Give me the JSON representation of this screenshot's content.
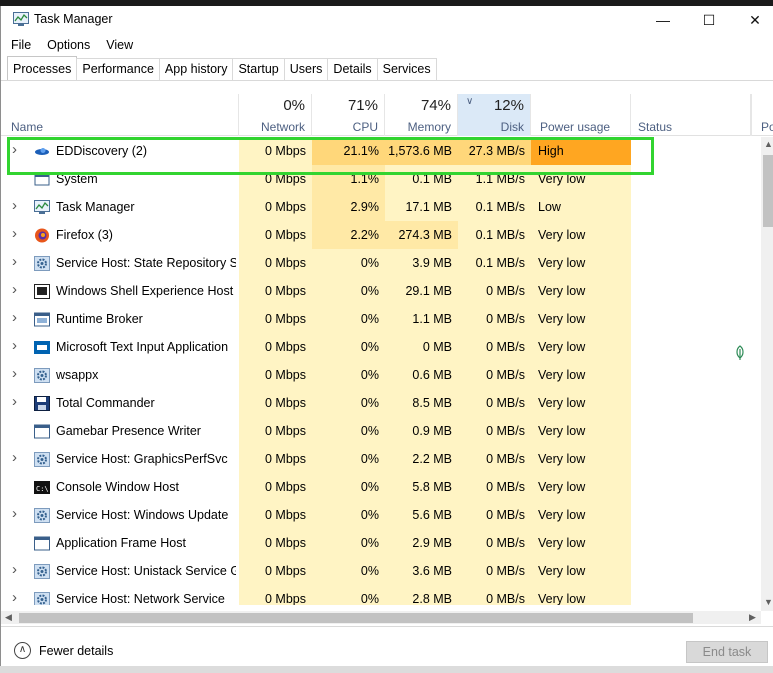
{
  "window": {
    "title": "Task Manager",
    "minimize_glyph": "—",
    "maximize_glyph": "☐",
    "close_glyph": "✕"
  },
  "menu": [
    "File",
    "Options",
    "View"
  ],
  "tabs": [
    "Processes",
    "Performance",
    "App history",
    "Startup",
    "Users",
    "Details",
    "Services"
  ],
  "header": {
    "name": "Name",
    "network": {
      "pct": "0%",
      "label": "Network"
    },
    "cpu": {
      "pct": "71%",
      "label": "CPU"
    },
    "memory": {
      "pct": "74%",
      "label": "Memory"
    },
    "disk": {
      "pct": "12%",
      "label": "Disk"
    },
    "power": "Power usage",
    "status": "Status",
    "more": "Po"
  },
  "rows": [
    {
      "name": "EDDiscovery (2)",
      "expand": true,
      "icon": "eddiscovery-icon",
      "network": "0 Mbps",
      "cpu": "21.1%",
      "memory": "1,573.6 MB",
      "disk": "27.3 MB/s",
      "power": "High"
    },
    {
      "name": "System",
      "expand": false,
      "icon": "system-window-icon",
      "network": "0 Mbps",
      "cpu": "1.1%",
      "memory": "0.1 MB",
      "disk": "1.1 MB/s",
      "power": "Very low"
    },
    {
      "name": "Task Manager",
      "expand": true,
      "icon": "task-manager-icon",
      "network": "0 Mbps",
      "cpu": "2.9%",
      "memory": "17.1 MB",
      "disk": "0.1 MB/s",
      "power": "Low"
    },
    {
      "name": "Firefox (3)",
      "expand": true,
      "icon": "firefox-icon",
      "network": "0 Mbps",
      "cpu": "2.2%",
      "memory": "274.3 MB",
      "disk": "0.1 MB/s",
      "power": "Very low"
    },
    {
      "name": "Service Host: State Repository S...",
      "expand": true,
      "icon": "gear-icon",
      "network": "0 Mbps",
      "cpu": "0%",
      "memory": "3.9 MB",
      "disk": "0.1 MB/s",
      "power": "Very low"
    },
    {
      "name": "Windows Shell Experience Host",
      "expand": true,
      "icon": "shell-host-icon",
      "network": "0 Mbps",
      "cpu": "0%",
      "memory": "29.1 MB",
      "disk": "0 MB/s",
      "power": "Very low"
    },
    {
      "name": "Runtime Broker",
      "expand": true,
      "icon": "runtime-broker-icon",
      "network": "0 Mbps",
      "cpu": "0%",
      "memory": "1.1 MB",
      "disk": "0 MB/s",
      "power": "Very low"
    },
    {
      "name": "Microsoft Text Input Application",
      "expand": true,
      "icon": "text-input-icon",
      "network": "0 Mbps",
      "cpu": "0%",
      "memory": "0 MB",
      "disk": "0 MB/s",
      "power": "Very low"
    },
    {
      "name": "wsappx",
      "expand": true,
      "icon": "gear-icon",
      "network": "0 Mbps",
      "cpu": "0%",
      "memory": "0.6 MB",
      "disk": "0 MB/s",
      "power": "Very low"
    },
    {
      "name": "Total Commander",
      "expand": true,
      "icon": "floppy-disk-icon",
      "network": "0 Mbps",
      "cpu": "0%",
      "memory": "8.5 MB",
      "disk": "0 MB/s",
      "power": "Very low"
    },
    {
      "name": "Gamebar Presence Writer",
      "expand": false,
      "icon": "app-window-icon",
      "network": "0 Mbps",
      "cpu": "0%",
      "memory": "0.9 MB",
      "disk": "0 MB/s",
      "power": "Very low"
    },
    {
      "name": "Service Host: GraphicsPerfSvc",
      "expand": true,
      "icon": "gear-icon",
      "network": "0 Mbps",
      "cpu": "0%",
      "memory": "2.2 MB",
      "disk": "0 MB/s",
      "power": "Very low"
    },
    {
      "name": "Console Window Host",
      "expand": false,
      "icon": "console-icon",
      "network": "0 Mbps",
      "cpu": "0%",
      "memory": "5.8 MB",
      "disk": "0 MB/s",
      "power": "Very low"
    },
    {
      "name": "Service Host: Windows Update",
      "expand": true,
      "icon": "gear-icon",
      "network": "0 Mbps",
      "cpu": "0%",
      "memory": "5.6 MB",
      "disk": "0 MB/s",
      "power": "Very low"
    },
    {
      "name": "Application Frame Host",
      "expand": false,
      "icon": "app-window-icon",
      "network": "0 Mbps",
      "cpu": "0%",
      "memory": "2.9 MB",
      "disk": "0 MB/s",
      "power": "Very low"
    },
    {
      "name": "Service Host: Unistack Service G...",
      "expand": true,
      "icon": "gear-icon",
      "network": "0 Mbps",
      "cpu": "0%",
      "memory": "3.6 MB",
      "disk": "0 MB/s",
      "power": "Very low"
    },
    {
      "name": "Service Host: Network Service",
      "expand": true,
      "icon": "gear-icon",
      "network": "0 Mbps",
      "cpu": "0%",
      "memory": "2.8 MB",
      "disk": "0 MB/s",
      "power": "Very low"
    }
  ],
  "footer": {
    "fewer_details": "Fewer details",
    "end_task": "End task"
  },
  "colors": {
    "cell_light": "#fff4c4",
    "cell_medium": "#ffe9a6",
    "cell_strong": "#ffd77a",
    "power_high": "#ffa621",
    "highlight": "#32d430",
    "header_text": "#4d6082"
  }
}
